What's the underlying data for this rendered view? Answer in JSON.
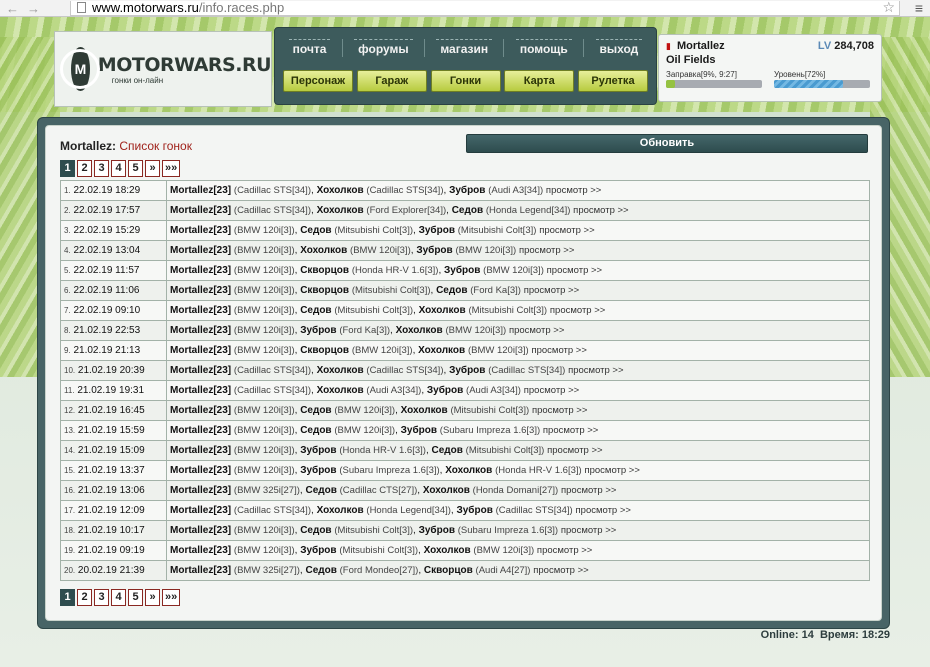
{
  "browser": {
    "url_domain": "www.motorwars.ru",
    "url_path": "/info.races.php"
  },
  "logo": {
    "name": "MOTORWARS.RU",
    "tagline": "гонки он-лайн"
  },
  "nav": {
    "top": [
      "почта",
      "форумы",
      "магазин",
      "помощь",
      "выход"
    ],
    "buttons": [
      "Персонаж",
      "Гараж",
      "Гонки",
      "Карта",
      "Рулетка"
    ]
  },
  "player": {
    "name": "Mortallez",
    "lv_prefix": "LV",
    "lv_value": "284,708",
    "location": "Oil Fields",
    "fuel_label": "Заправка[9%, 9:27]",
    "fuel_pct": 9,
    "level_label": "Уровень[72%]",
    "level_pct": 72
  },
  "page": {
    "owner": "Mortallez:",
    "title": "Список гонок",
    "refresh": "Обновить"
  },
  "pager": [
    "1",
    "2",
    "3",
    "4",
    "5",
    "»",
    "»»"
  ],
  "races": [
    {
      "n": "1.",
      "date": "22.02.19 18:29",
      "p": [
        [
          "Mortallez[23]",
          "(Cadillac STS[34])"
        ],
        [
          "Хохолков",
          "(Cadillac STS[34])"
        ],
        [
          "Зубров",
          "(Audi A3[34])"
        ]
      ],
      "link": "просмотр >>"
    },
    {
      "n": "2.",
      "date": "22.02.19 17:57",
      "p": [
        [
          "Mortallez[23]",
          "(Cadillac STS[34])"
        ],
        [
          "Хохолков",
          "(Ford Explorer[34])"
        ],
        [
          "Седов",
          "(Honda Legend[34])"
        ]
      ],
      "link": "просмотр >>"
    },
    {
      "n": "3.",
      "date": "22.02.19 15:29",
      "p": [
        [
          "Mortallez[23]",
          "(BMW 120i[3])"
        ],
        [
          "Седов",
          "(Mitsubishi Colt[3])"
        ],
        [
          "Зубров",
          "(Mitsubishi Colt[3])"
        ]
      ],
      "link": "просмотр >>"
    },
    {
      "n": "4.",
      "date": "22.02.19 13:04",
      "p": [
        [
          "Mortallez[23]",
          "(BMW 120i[3])"
        ],
        [
          "Хохолков",
          "(BMW 120i[3])"
        ],
        [
          "Зубров",
          "(BMW 120i[3])"
        ]
      ],
      "link": "просмотр >>"
    },
    {
      "n": "5.",
      "date": "22.02.19 11:57",
      "p": [
        [
          "Mortallez[23]",
          "(BMW 120i[3])"
        ],
        [
          "Скворцов",
          "(Honda HR-V 1.6[3])"
        ],
        [
          "Зубров",
          "(BMW 120i[3])"
        ]
      ],
      "link": "просмотр >>"
    },
    {
      "n": "6.",
      "date": "22.02.19 11:06",
      "p": [
        [
          "Mortallez[23]",
          "(BMW 120i[3])"
        ],
        [
          "Скворцов",
          "(Mitsubishi Colt[3])"
        ],
        [
          "Седов",
          "(Ford Ka[3])"
        ]
      ],
      "link": "просмотр >>"
    },
    {
      "n": "7.",
      "date": "22.02.19 09:10",
      "p": [
        [
          "Mortallez[23]",
          "(BMW 120i[3])"
        ],
        [
          "Седов",
          "(Mitsubishi Colt[3])"
        ],
        [
          "Хохолков",
          "(Mitsubishi Colt[3])"
        ]
      ],
      "link": "просмотр >>"
    },
    {
      "n": "8.",
      "date": "21.02.19 22:53",
      "p": [
        [
          "Mortallez[23]",
          "(BMW 120i[3])"
        ],
        [
          "Зубров",
          "(Ford Ka[3])"
        ],
        [
          "Хохолков",
          "(BMW 120i[3])"
        ]
      ],
      "link": "просмотр >>"
    },
    {
      "n": "9.",
      "date": "21.02.19 21:13",
      "p": [
        [
          "Mortallez[23]",
          "(BMW 120i[3])"
        ],
        [
          "Скворцов",
          "(BMW 120i[3])"
        ],
        [
          "Хохолков",
          "(BMW 120i[3])"
        ]
      ],
      "link": "просмотр >>"
    },
    {
      "n": "10.",
      "date": "21.02.19 20:39",
      "p": [
        [
          "Mortallez[23]",
          "(Cadillac STS[34])"
        ],
        [
          "Хохолков",
          "(Cadillac STS[34])"
        ],
        [
          "Зубров",
          "(Cadillac STS[34])"
        ]
      ],
      "link": "просмотр >>"
    },
    {
      "n": "11.",
      "date": "21.02.19 19:31",
      "p": [
        [
          "Mortallez[23]",
          "(Cadillac STS[34])"
        ],
        [
          "Хохолков",
          "(Audi A3[34])"
        ],
        [
          "Зубров",
          "(Audi A3[34])"
        ]
      ],
      "link": "просмотр >>"
    },
    {
      "n": "12.",
      "date": "21.02.19 16:45",
      "p": [
        [
          "Mortallez[23]",
          "(BMW 120i[3])"
        ],
        [
          "Седов",
          "(BMW 120i[3])"
        ],
        [
          "Хохолков",
          "(Mitsubishi Colt[3])"
        ]
      ],
      "link": "просмотр >>"
    },
    {
      "n": "13.",
      "date": "21.02.19 15:59",
      "p": [
        [
          "Mortallez[23]",
          "(BMW 120i[3])"
        ],
        [
          "Седов",
          "(BMW 120i[3])"
        ],
        [
          "Зубров",
          "(Subaru Impreza 1.6[3])"
        ]
      ],
      "link": "просмотр >>"
    },
    {
      "n": "14.",
      "date": "21.02.19 15:09",
      "p": [
        [
          "Mortallez[23]",
          "(BMW 120i[3])"
        ],
        [
          "Зубров",
          "(Honda HR-V 1.6[3])"
        ],
        [
          "Седов",
          "(Mitsubishi Colt[3])"
        ]
      ],
      "link": "просмотр >>"
    },
    {
      "n": "15.",
      "date": "21.02.19 13:37",
      "p": [
        [
          "Mortallez[23]",
          "(BMW 120i[3])"
        ],
        [
          "Зубров",
          "(Subaru Impreza 1.6[3])"
        ],
        [
          "Хохолков",
          "(Honda HR-V 1.6[3])"
        ]
      ],
      "link": "просмотр >>"
    },
    {
      "n": "16.",
      "date": "21.02.19 13:06",
      "p": [
        [
          "Mortallez[23]",
          "(BMW 325i[27])"
        ],
        [
          "Седов",
          "(Cadillac CTS[27])"
        ],
        [
          "Хохолков",
          "(Honda Domani[27])"
        ]
      ],
      "link": "просмотр >>"
    },
    {
      "n": "17.",
      "date": "21.02.19 12:09",
      "p": [
        [
          "Mortallez[23]",
          "(Cadillac STS[34])"
        ],
        [
          "Хохолков",
          "(Honda Legend[34])"
        ],
        [
          "Зубров",
          "(Cadillac STS[34])"
        ]
      ],
      "link": "просмотр >>"
    },
    {
      "n": "18.",
      "date": "21.02.19 10:17",
      "p": [
        [
          "Mortallez[23]",
          "(BMW 120i[3])"
        ],
        [
          "Седов",
          "(Mitsubishi Colt[3])"
        ],
        [
          "Зубров",
          "(Subaru Impreza 1.6[3])"
        ]
      ],
      "link": "просмотр >>"
    },
    {
      "n": "19.",
      "date": "21.02.19 09:19",
      "p": [
        [
          "Mortallez[23]",
          "(BMW 120i[3])"
        ],
        [
          "Зубров",
          "(Mitsubishi Colt[3])"
        ],
        [
          "Хохолков",
          "(BMW 120i[3])"
        ]
      ],
      "link": "просмотр >>"
    },
    {
      "n": "20.",
      "date": "20.02.19 21:39",
      "p": [
        [
          "Mortallez[23]",
          "(BMW 325i[27])"
        ],
        [
          "Седов",
          "(Ford Mondeo[27])"
        ],
        [
          "Скворцов",
          "(Audi A4[27])"
        ]
      ],
      "link": "просмотр >>"
    }
  ],
  "footer": {
    "online": "Online: 14",
    "time": "Время: 18:29"
  }
}
